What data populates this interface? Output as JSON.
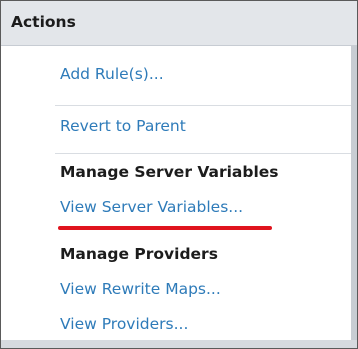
{
  "actions_panel": {
    "header": "Actions",
    "links": {
      "add_rules": "Add Rule(s)...",
      "revert_to_parent": "Revert to Parent"
    },
    "manage_server_variables": {
      "title": "Manage Server Variables",
      "view_server_variables": "View Server Variables..."
    },
    "manage_providers": {
      "title": "Manage Providers",
      "view_rewrite_maps": "View Rewrite Maps...",
      "view_providers": "View Providers..."
    },
    "highlight_color": "#e0141e",
    "link_color": "#2e7bb9"
  }
}
